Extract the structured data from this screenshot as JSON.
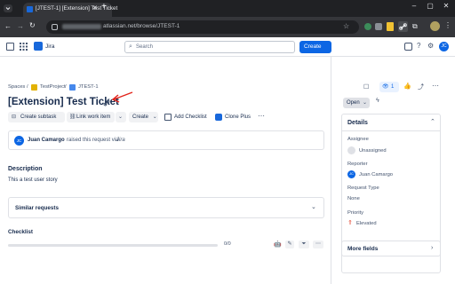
{
  "browser": {
    "tab_title": "[JTEST-1] [Extension] Test Ticket",
    "new_tab": "+",
    "url_prefix": "",
    "url_text": "atlassian.net/browse/JTEST-1",
    "win_min": "–",
    "win_max": "▢",
    "win_close": "✕"
  },
  "jira": {
    "product_name": "Jira",
    "search_placeholder": "Search",
    "create_label": "Create",
    "breadcrumb": {
      "spaces": "Spaces",
      "sep1": "/",
      "project": "TestProject",
      "sep2": "/",
      "issue_key": "JTEST-1"
    },
    "issue_title": "[Extension] Test Ticket",
    "actions": {
      "create_subtask": "Create subtask",
      "link_work_item": "Link work item",
      "create": "Create",
      "add_checklist": "Add Checklist",
      "clone_plus": "Clone Plus",
      "more": "⋯"
    },
    "activity": {
      "avatar": "JC",
      "user": "Juan Camargo",
      "text": "raised this request via",
      "channel": "Jira"
    },
    "description_heading": "Description",
    "description_text": "This a test user story",
    "similar_requests": "Similar requests",
    "checklist_heading": "Checklist",
    "checklist_progress": "0/0",
    "watch_count": "1",
    "status": "Open",
    "details": {
      "heading": "Details",
      "assignee_label": "Assignee",
      "assignee_value": "Unassigned",
      "reporter_label": "Reporter",
      "reporter_avatar": "JC",
      "reporter_value": "Juan Camargo",
      "request_type_label": "Request Type",
      "request_type_value": "None",
      "priority_label": "Priority",
      "priority_value": "Elevated"
    },
    "more_fields": "More fields",
    "header_avatar": "JC"
  },
  "colors": {
    "accent": "#0c66e4",
    "annotation_arrow": "#e2231a",
    "priority": "#e34935"
  }
}
